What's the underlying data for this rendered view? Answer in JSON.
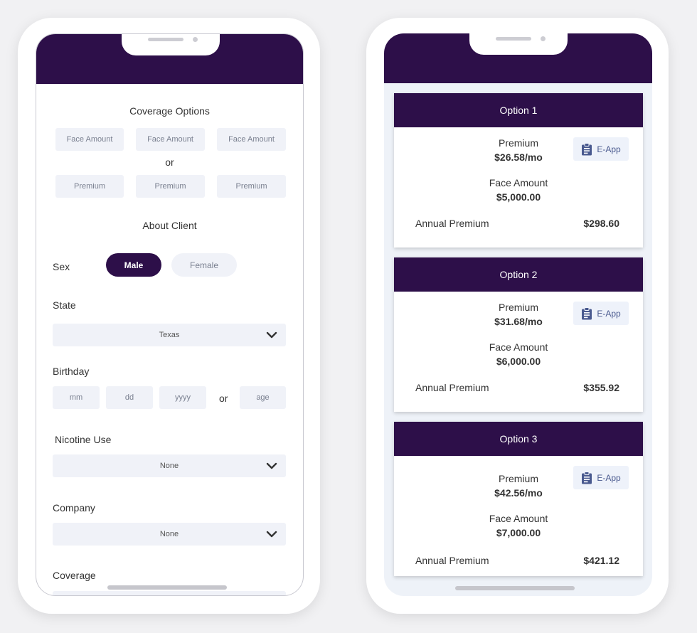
{
  "form": {
    "coverage_title": "Coverage Options",
    "face_amount_placeholders": [
      "Face Amount",
      "Face Amount",
      "Face Amount"
    ],
    "or_label": "or",
    "premium_placeholders": [
      "Premium",
      "Premium",
      "Premium"
    ],
    "about_title": "About Client",
    "sex_label": "Sex",
    "sex_options": [
      "Male",
      "Female"
    ],
    "sex_selected": "Male",
    "state_label": "State",
    "state_value": "Texas",
    "birthday_label": "Birthday",
    "birthday_placeholders": [
      "mm",
      "dd",
      "yyyy"
    ],
    "birthday_or": "or",
    "age_placeholder": "age",
    "nicotine_label": "Nicotine Use",
    "nicotine_value": "None",
    "company_label": "Company",
    "company_value": "None",
    "coverage_label": "Coverage"
  },
  "results": {
    "options": [
      {
        "title": "Option 1",
        "premium_label": "Premium",
        "premium": "$26.58/mo",
        "face_label": "Face Amount",
        "face": "$5,000.00",
        "annual_label": "Annual Premium",
        "annual": "$298.60",
        "eapp_label": "E-App"
      },
      {
        "title": "Option 2",
        "premium_label": "Premium",
        "premium": "$31.68/mo",
        "face_label": "Face Amount",
        "face": "$6,000.00",
        "annual_label": "Annual Premium",
        "annual": "$355.92",
        "eapp_label": "E-App"
      },
      {
        "title": "Option 3",
        "premium_label": "Premium",
        "premium": "$42.56/mo",
        "face_label": "Face Amount",
        "face": "$7,000.00",
        "annual_label": "Annual Premium",
        "annual": "$421.12",
        "eapp_label": "E-App"
      }
    ]
  },
  "colors": {
    "brand": "#2d0f49",
    "field_bg": "#f0f2f8",
    "eapp_accent": "#4a5a8f"
  },
  "icons": {
    "chevron": "chevron-down-icon",
    "eapp": "clipboard-icon"
  }
}
